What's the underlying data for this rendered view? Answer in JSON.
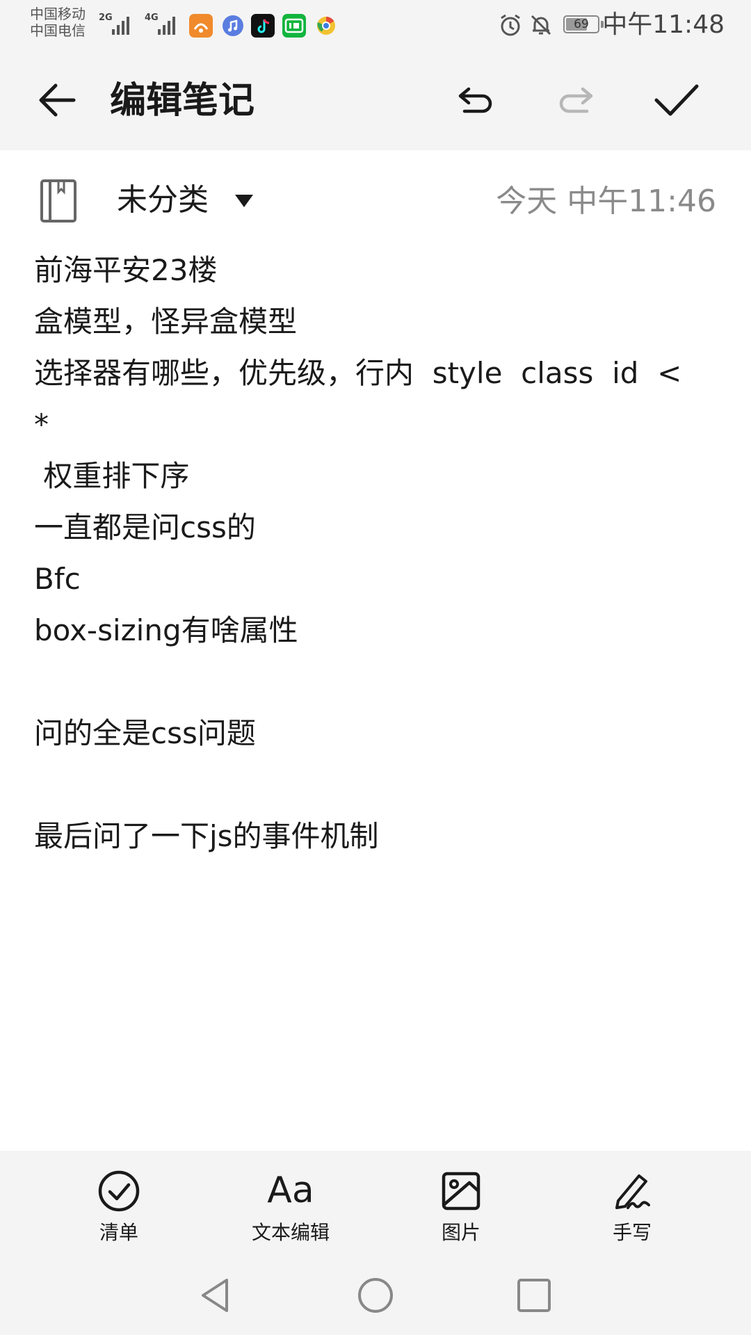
{
  "status_bar": {
    "carrier_1": "中国移动",
    "carrier_2": "中国电信",
    "sim1_network": "2G",
    "sim2_network": "4G",
    "battery_level": "69",
    "battery_fraction": 0.69,
    "time": "中午11:48",
    "app_icons": [
      "uc-browser-icon",
      "music-icon",
      "tiktok-icon",
      "iqiyi-icon",
      "chrome-like-icon"
    ],
    "status_icons": [
      "alarm-icon",
      "notifications-off-icon",
      "battery-icon"
    ]
  },
  "toolbar": {
    "title": "编辑笔记",
    "back_icon": "arrow-left-icon",
    "undo_icon": "undo-icon",
    "redo_icon": "redo-icon",
    "confirm_icon": "check-icon"
  },
  "meta": {
    "category": "未分类",
    "timestamp": "今天 中午11:46"
  },
  "note": {
    "lines": [
      "前海平安23楼",
      "盒模型，怪异盒模型",
      "选择器有哪些，优先级，行内  style  class  id  <",
      "*",
      " 权重排下序",
      "一直都是问css的",
      "Bfc",
      "box-sizing有啥属性",
      "",
      "问的全是css问题",
      "",
      "最后问了一下js的事件机制"
    ]
  },
  "format_bar": {
    "checklist": "清单",
    "text_edit": "文本编辑",
    "text_edit_glyph": "Aa",
    "image": "图片",
    "handwriting": "手写"
  },
  "colors": {
    "bar_background": "#f4f4f4",
    "text_primary": "#1a1a1a",
    "text_secondary": "#8a8a8a"
  }
}
